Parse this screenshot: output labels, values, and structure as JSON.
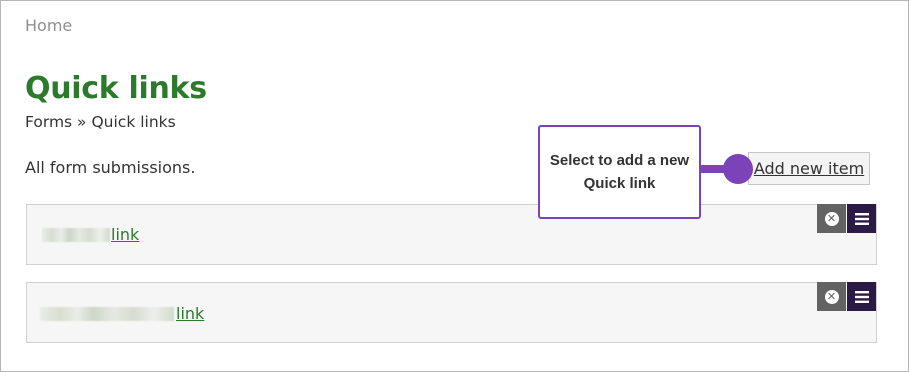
{
  "nav": {
    "home": "Home"
  },
  "page": {
    "title": "Quick links",
    "breadcrumb": {
      "parent": "Forms",
      "separator": " » ",
      "current": "Quick links"
    },
    "intro": "All form submissions."
  },
  "toolbar": {
    "add_label": "Add new item"
  },
  "callout": {
    "line1": "Select to add a new",
    "line2": "Quick link"
  },
  "items": [
    {
      "link_label": "link",
      "actions": [
        "delete-icon",
        "menu-icon"
      ]
    },
    {
      "link_label": "link",
      "actions": [
        "delete-icon",
        "menu-icon"
      ]
    }
  ],
  "colors": {
    "title": "#2c7a2c",
    "link": "#2c7a2c",
    "callout_accent": "#7c42b7",
    "delete_button": "#636363",
    "menu_button": "#2b1a45"
  }
}
